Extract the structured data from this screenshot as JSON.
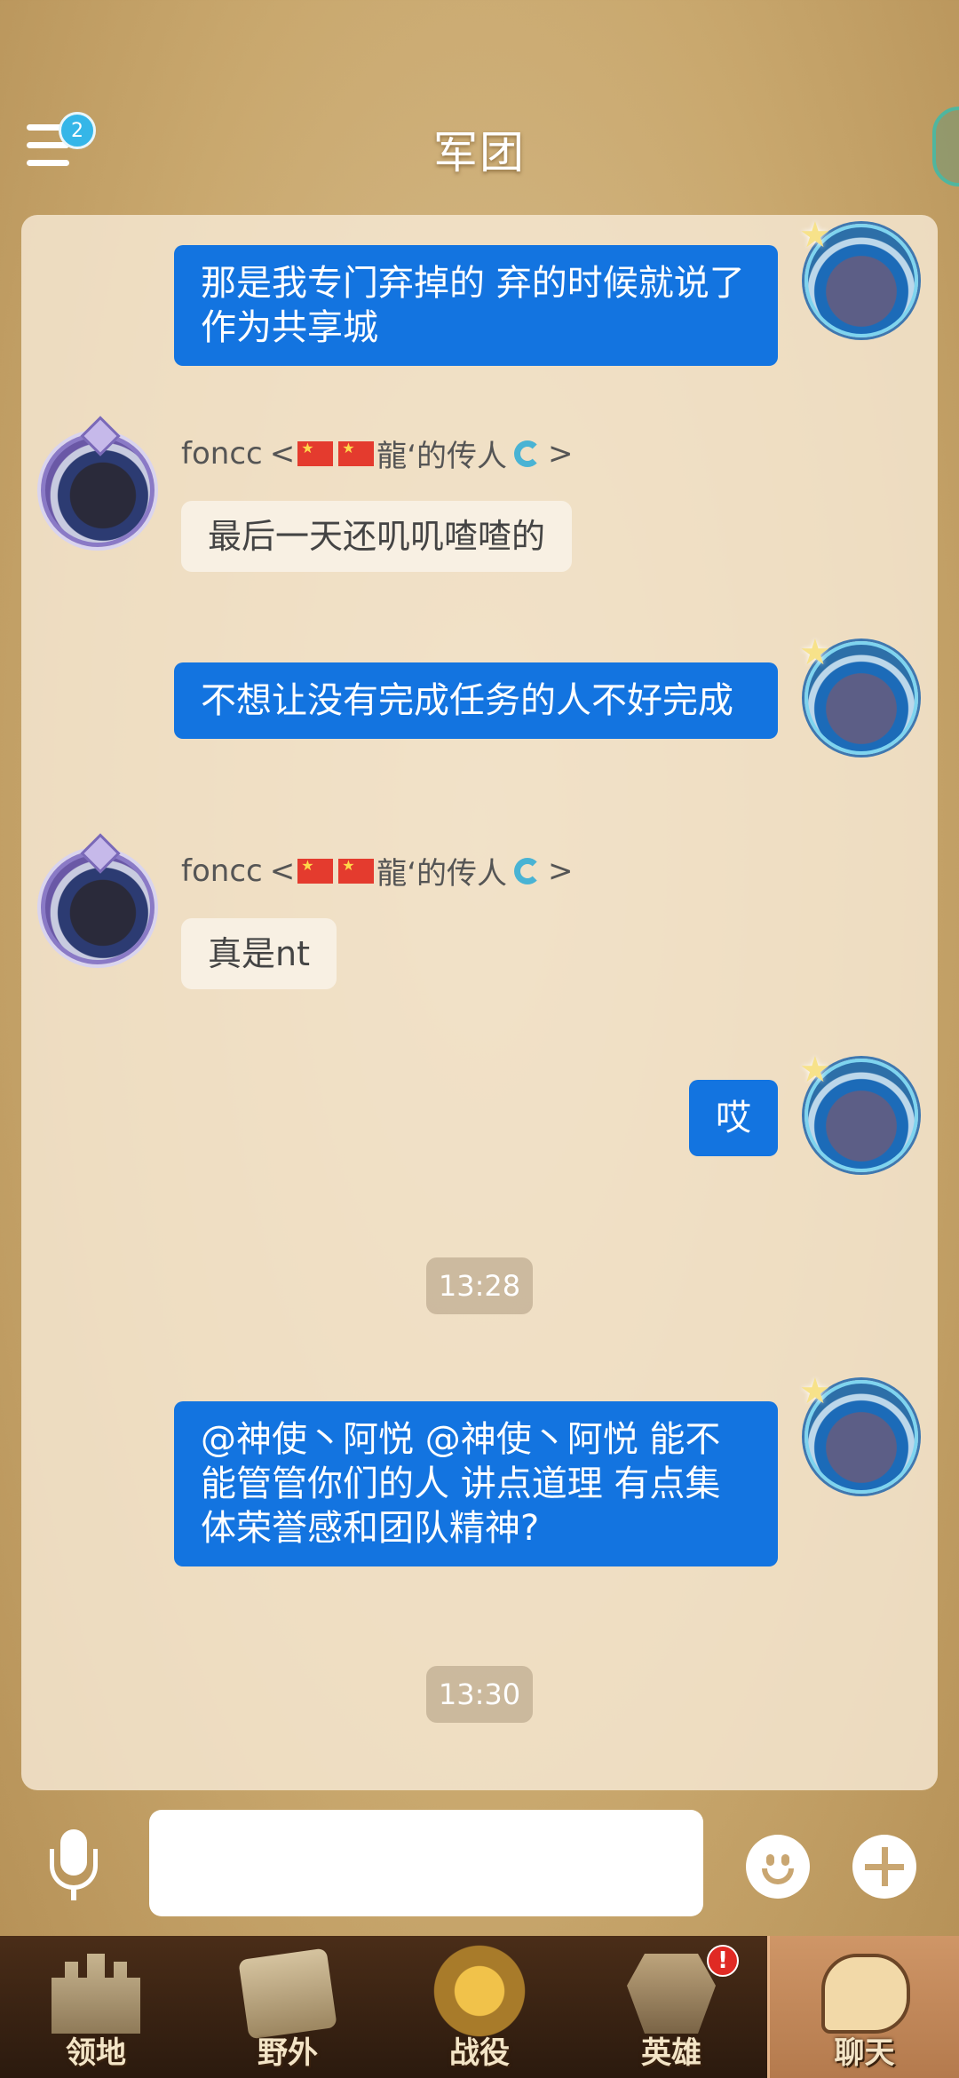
{
  "header": {
    "title": "军团",
    "menu_badge": "2"
  },
  "messages": [
    {
      "type": "self",
      "text": "那是我专门弃掉的 弃的时候就说了作为共享城"
    },
    {
      "type": "other",
      "sender_name": "foncc",
      "sender_open": "<",
      "sender_suffix": "龍‘的传人",
      "sender_close": ">",
      "text": "最后一天还叽叽喳喳的"
    },
    {
      "type": "self",
      "text": "不想让没有完成任务的人不好完成"
    },
    {
      "type": "other",
      "sender_name": "foncc",
      "sender_open": "<",
      "sender_suffix": "龍‘的传人",
      "sender_close": ">",
      "text": "真是nt"
    },
    {
      "type": "self",
      "text": "哎"
    },
    {
      "type": "time",
      "text": "13:28"
    },
    {
      "type": "self",
      "text": "@神使丶阿悦 @神使丶阿悦 能不能管管你们的人 讲点道理 有点集体荣誉感和团队精神?"
    },
    {
      "type": "time",
      "text": "13:30"
    }
  ],
  "input": {
    "placeholder": ""
  },
  "nav": {
    "items": [
      {
        "label": "领地",
        "icon": "castle-icon"
      },
      {
        "label": "野外",
        "icon": "scroll-map-icon"
      },
      {
        "label": "战役",
        "icon": "battle-shield-icon"
      },
      {
        "label": "英雄",
        "icon": "hero-helmet-icon",
        "alert": "!"
      },
      {
        "label": "聊天",
        "icon": "chat-bubble-icon",
        "active": true
      }
    ]
  },
  "colors": {
    "self_bubble": "#1374e0",
    "other_bubble": "#f8f0e3",
    "badge": "#35b6e8",
    "alert": "#e02a24"
  }
}
